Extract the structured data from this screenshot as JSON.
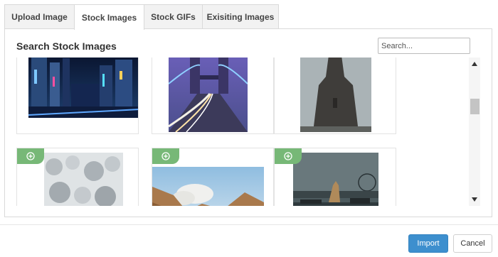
{
  "tabs": [
    {
      "label": "Upload Image",
      "active": false
    },
    {
      "label": "Stock Images",
      "active": true
    },
    {
      "label": "Stock GIFs",
      "active": false
    },
    {
      "label": "Exisiting Images",
      "active": false
    }
  ],
  "panel": {
    "title": "Search Stock Images",
    "search_placeholder": "Search..."
  },
  "images": [
    {
      "subject": "neon city street at night",
      "has_add_badge": false
    },
    {
      "subject": "bridge with light trails",
      "has_add_badge": false
    },
    {
      "subject": "church tower",
      "has_add_badge": false
    },
    {
      "subject": "snowy forest aerial",
      "has_add_badge": true
    },
    {
      "subject": "desert hills with clouds",
      "has_add_badge": true
    },
    {
      "subject": "city waterfront with statue",
      "has_add_badge": true
    }
  ],
  "icons": {
    "add": "plus-circle-icon",
    "scroll_up": "triangle-up-icon",
    "scroll_down": "triangle-down-icon"
  },
  "footer": {
    "import_label": "Import",
    "cancel_label": "Cancel"
  },
  "colors": {
    "primary": "#3d8fce",
    "add_badge": "#77b877",
    "border": "#d9d9d9"
  }
}
